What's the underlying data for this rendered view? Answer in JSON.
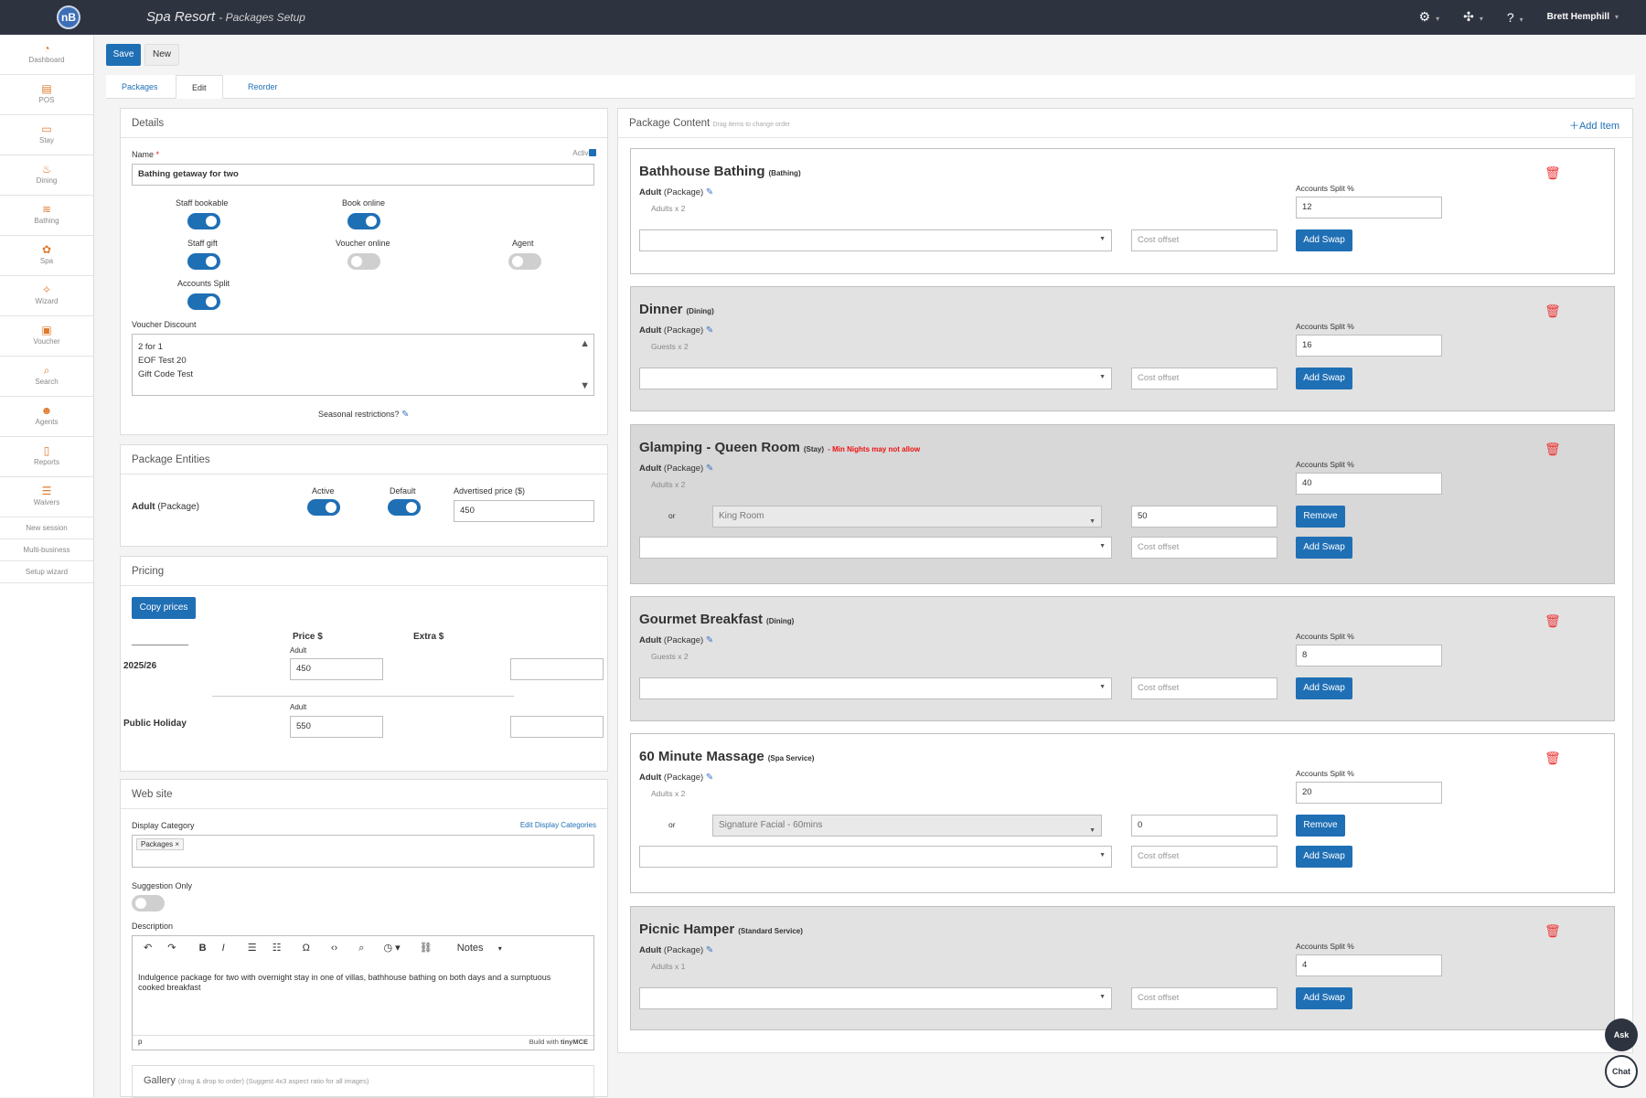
{
  "app": {
    "logo": "nB",
    "title": "Spa Resort",
    "subtitle": "Packages Setup",
    "user": "Brett Hemphill"
  },
  "sidebar": {
    "items": [
      {
        "label": "Dashboard",
        "icon": "dashboard-icon"
      },
      {
        "label": "POS",
        "icon": "pos-icon"
      },
      {
        "label": "Stay",
        "icon": "bed-icon"
      },
      {
        "label": "Dining",
        "icon": "dining-icon"
      },
      {
        "label": "Bathing",
        "icon": "bathing-icon"
      },
      {
        "label": "Spa",
        "icon": "spa-icon"
      },
      {
        "label": "Wizard",
        "icon": "wand-icon"
      },
      {
        "label": "Voucher",
        "icon": "gift-icon"
      },
      {
        "label": "Search",
        "icon": "search-icon"
      },
      {
        "label": "Agents",
        "icon": "agents-icon"
      },
      {
        "label": "Reports",
        "icon": "report-icon"
      },
      {
        "label": "Waivers",
        "icon": "list-icon"
      }
    ],
    "links": [
      "New session",
      "Multi-business",
      "Setup wizard"
    ]
  },
  "toolbar": {
    "save": "Save",
    "new": "New"
  },
  "tabs": [
    "Packages",
    "Edit",
    "Reorder"
  ],
  "details": {
    "title": "Details",
    "name_label": "Name",
    "required_mark": "*",
    "active_label": "Active",
    "name_value": "Bathing getaway for two",
    "toggles": {
      "staff_bookable": "Staff bookable",
      "book_online": "Book online",
      "staff_gift": "Staff gift",
      "voucher_online": "Voucher online",
      "agent": "Agent",
      "accounts_split": "Accounts Split"
    },
    "voucher_discount_label": "Voucher Discount",
    "voucher_options": [
      "2 for 1",
      "EOF Test 20",
      "Gift Code Test"
    ],
    "seasonal": "Seasonal restrictions?"
  },
  "entities": {
    "title": "Package Entities",
    "row_label": "Adult",
    "row_sub": "(Package)",
    "active": "Active",
    "default": "Default",
    "adv_price_label": "Advertised price ($)",
    "adv_price": "450"
  },
  "pricing": {
    "title": "Pricing",
    "copy": "Copy prices",
    "price_header": "Price $",
    "extra_header": "Extra $",
    "rows": [
      {
        "season": "2025/26",
        "sub": "Adult",
        "price": "450"
      },
      {
        "season": "Public Holiday",
        "sub": "Adult",
        "price": "550"
      }
    ]
  },
  "website": {
    "title": "Web site",
    "display_category": "Display Category",
    "edit_categories": "Edit Display Categories",
    "chip": "Packages",
    "chip_x": "×",
    "suggestion": "Suggestion Only",
    "description": "Description",
    "notes": "Notes",
    "desc_text": "Indulgence package for two with overnight stay in one of villas, bathhouse bathing on both days and a sumptuous cooked breakfast",
    "status_p": "p",
    "built_with": "Build with",
    "tiny": "tinyMCE",
    "gallery": "Gallery",
    "gallery_hint": "(drag & drop to order) (Suggest 4x3 aspect ratio for all images)"
  },
  "content": {
    "title": "Package Content",
    "hint": "Drag items to change order",
    "add_item": "Add Item",
    "split_label": "Accounts Split %",
    "cost_ph": "Cost offset",
    "add_swap": "Add Swap",
    "remove": "Remove",
    "or": "or",
    "adult": "Adult",
    "pkg": "(Package)",
    "items": [
      {
        "name": "Bathhouse Bathing",
        "tag": "(Bathing)",
        "warn": "",
        "qty": "Adults x 2",
        "split": "12",
        "swap_name": "",
        "swap_cost": ""
      },
      {
        "name": "Dinner",
        "tag": "(Dining)",
        "warn": "",
        "qty": "Guests x 2",
        "split": "16",
        "swap_name": "",
        "swap_cost": ""
      },
      {
        "name": "Glamping - Queen Room",
        "tag": "(Stay)",
        "warn": "- Min Nights may not allow",
        "qty": "Adults x 2",
        "split": "40",
        "swap_name": "King Room",
        "swap_cost": "50"
      },
      {
        "name": "Gourmet Breakfast",
        "tag": "(Dining)",
        "warn": "",
        "qty": "Guests x 2",
        "split": "8",
        "swap_name": "",
        "swap_cost": ""
      },
      {
        "name": "60 Minute Massage",
        "tag": "(Spa Service)",
        "warn": "",
        "qty": "Adults x 2",
        "split": "20",
        "swap_name": "Signature Facial - 60mins",
        "swap_cost": "0"
      },
      {
        "name": "Picnic Hamper",
        "tag": "(Standard Service)",
        "warn": "",
        "qty": "Adults x 1",
        "split": "4",
        "swap_name": "",
        "swap_cost": ""
      }
    ]
  },
  "float": {
    "ask": "Ask",
    "chat": "Chat"
  }
}
